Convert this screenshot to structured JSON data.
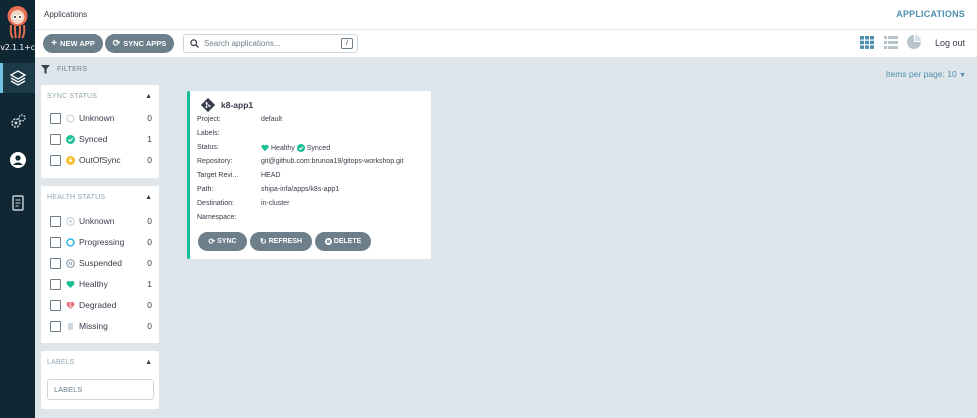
{
  "nav": {
    "version": "v2.1.1+c",
    "items": [
      {
        "icon": "layers-icon"
      },
      {
        "icon": "gears-icon"
      },
      {
        "icon": "user-icon"
      },
      {
        "icon": "docs-icon"
      }
    ]
  },
  "topbar": {
    "breadcrumb": "Applications",
    "title": "APPLICATIONS"
  },
  "toolbar": {
    "new_app": "NEW APP",
    "sync_apps": "SYNC APPS",
    "search_placeholder": "Search applications...",
    "search_shortcut": "/",
    "logout": "Log out"
  },
  "filters": {
    "title": "FILTERS",
    "sync_status": {
      "title": "SYNC STATUS",
      "items": [
        {
          "label": "Unknown",
          "count": "0",
          "color": "#ccd6dd"
        },
        {
          "label": "Synced",
          "count": "1",
          "color": "#18be94"
        },
        {
          "label": "OutOfSync",
          "count": "0",
          "color": "#f4c030"
        }
      ]
    },
    "health_status": {
      "title": "HEALTH STATUS",
      "items": [
        {
          "label": "Unknown",
          "count": "0",
          "color": "#ccd6dd"
        },
        {
          "label": "Progressing",
          "count": "0",
          "color": "#0dadea"
        },
        {
          "label": "Suspended",
          "count": "0",
          "color": "#8fa4b1"
        },
        {
          "label": "Healthy",
          "count": "1",
          "color": "#18be94"
        },
        {
          "label": "Degraded",
          "count": "0",
          "color": "#e96d76"
        },
        {
          "label": "Missing",
          "count": "0",
          "color": "#ccd6dd"
        }
      ]
    },
    "labels": {
      "title": "LABELS",
      "placeholder": "LABELS"
    }
  },
  "items_per_page": "Items per page: 10",
  "app": {
    "name": "k8-app1",
    "fields": [
      {
        "key": "Project:",
        "value": "default"
      },
      {
        "key": "Labels:",
        "value": ""
      },
      {
        "key": "Status:",
        "value": ""
      },
      {
        "key": "Repository:",
        "value": "git@github.com:brunoa19/gitops-workshop.git"
      },
      {
        "key": "Target Revi...",
        "value": "HEAD"
      },
      {
        "key": "Path:",
        "value": "shipa-infa/apps/k8s-app1"
      },
      {
        "key": "Destination:",
        "value": "in-cluster"
      },
      {
        "key": "Namespace:",
        "value": ""
      }
    ],
    "health": "Healthy",
    "sync": "Synced",
    "buttons": {
      "sync": "SYNC",
      "refresh": "REFRESH",
      "delete": "DELETE"
    }
  },
  "colors": {
    "accent": "#4d8fac",
    "healthy": "#18be94",
    "nav": "#0f2733"
  }
}
